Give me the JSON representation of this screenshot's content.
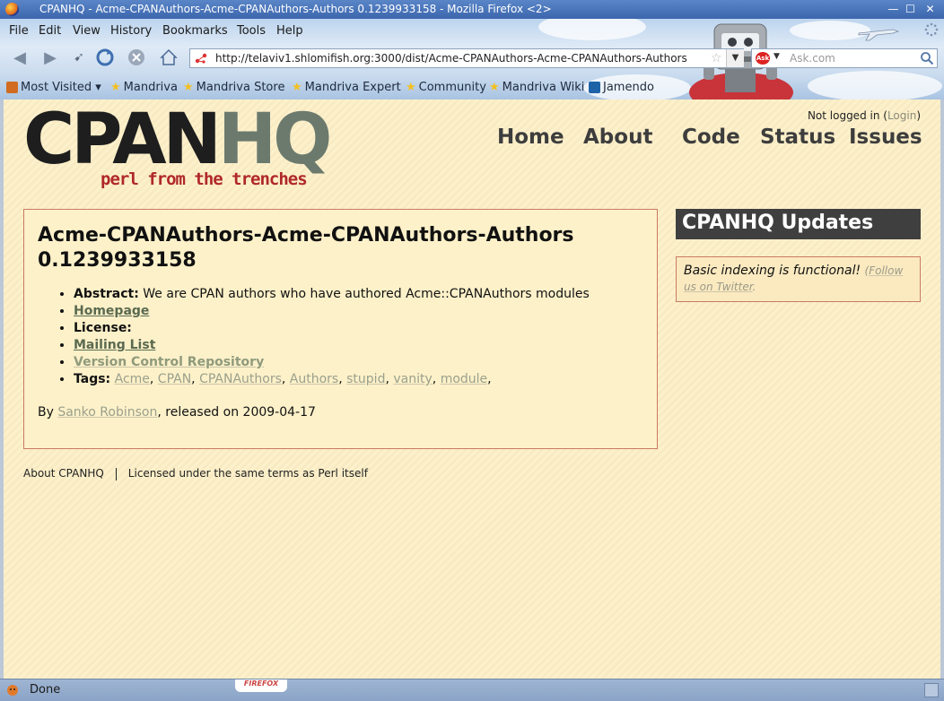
{
  "window": {
    "title": "CPANHQ - Acme-CPANAuthors-Acme-CPANAuthors-Authors 0.1239933158 - Mozilla Firefox <2>",
    "minimize": "—",
    "maximize": "☐",
    "close": "✕"
  },
  "menu": [
    "File",
    "Edit",
    "View",
    "History",
    "Bookmarks",
    "Tools",
    "Help"
  ],
  "toolbar": {
    "url": "http://telaviv1.shlomifish.org:3000/dist/Acme-CPANAuthors-Acme-CPANAuthors-Authors",
    "search_placeholder": "Ask.com"
  },
  "bookmarks": [
    {
      "label": "Most Visited ▾",
      "icon": "folder-icon"
    },
    {
      "label": "Mandriva",
      "icon": "star-icon"
    },
    {
      "label": "Mandriva Store",
      "icon": "star-icon"
    },
    {
      "label": "Mandriva Expert",
      "icon": "star-icon"
    },
    {
      "label": "Community",
      "icon": "star-icon"
    },
    {
      "label": "Mandriva Wiki",
      "icon": "star-icon"
    },
    {
      "label": "Jamendo",
      "icon": "jamendo-icon"
    }
  ],
  "site": {
    "logo_main": "CPAN",
    "logo_hq": "HQ",
    "logo_tagline": "perl from the trenches",
    "login_prefix": "Not logged in (",
    "login_link": "Login",
    "login_suffix": ")",
    "nav": [
      "Home",
      "About",
      "Code",
      "Status",
      "Issues"
    ]
  },
  "dist": {
    "title": "Acme-CPANAuthors-Acme-CPANAuthors-Authors 0.1239933158",
    "abstract_label": "Abstract:",
    "abstract": "We are CPAN authors who have authored Acme::CPANAuthors modules",
    "homepage": "Homepage",
    "license_label": "License:",
    "mailing_list": "Mailing List",
    "vcs": "Version Control Repository",
    "tags_label": "Tags:",
    "tags": [
      "Acme",
      "CPAN",
      "CPANAuthors",
      "Authors",
      "stupid",
      "vanity",
      "module"
    ],
    "by_prefix": "By ",
    "author": "Sanko Robinson",
    "released": ", released on 2009-04-17"
  },
  "updates": {
    "heading": "CPANHQ Updates",
    "message": "Basic indexing is functional!",
    "follow_prefix": "(",
    "follow_link": "Follow us on Twitter",
    "follow_suffix": "."
  },
  "footer": {
    "about": "About CPANHQ",
    "license": "Licensed under the same terms as Perl itself"
  },
  "status": {
    "text": "Done",
    "badge": "FIREFOX"
  }
}
